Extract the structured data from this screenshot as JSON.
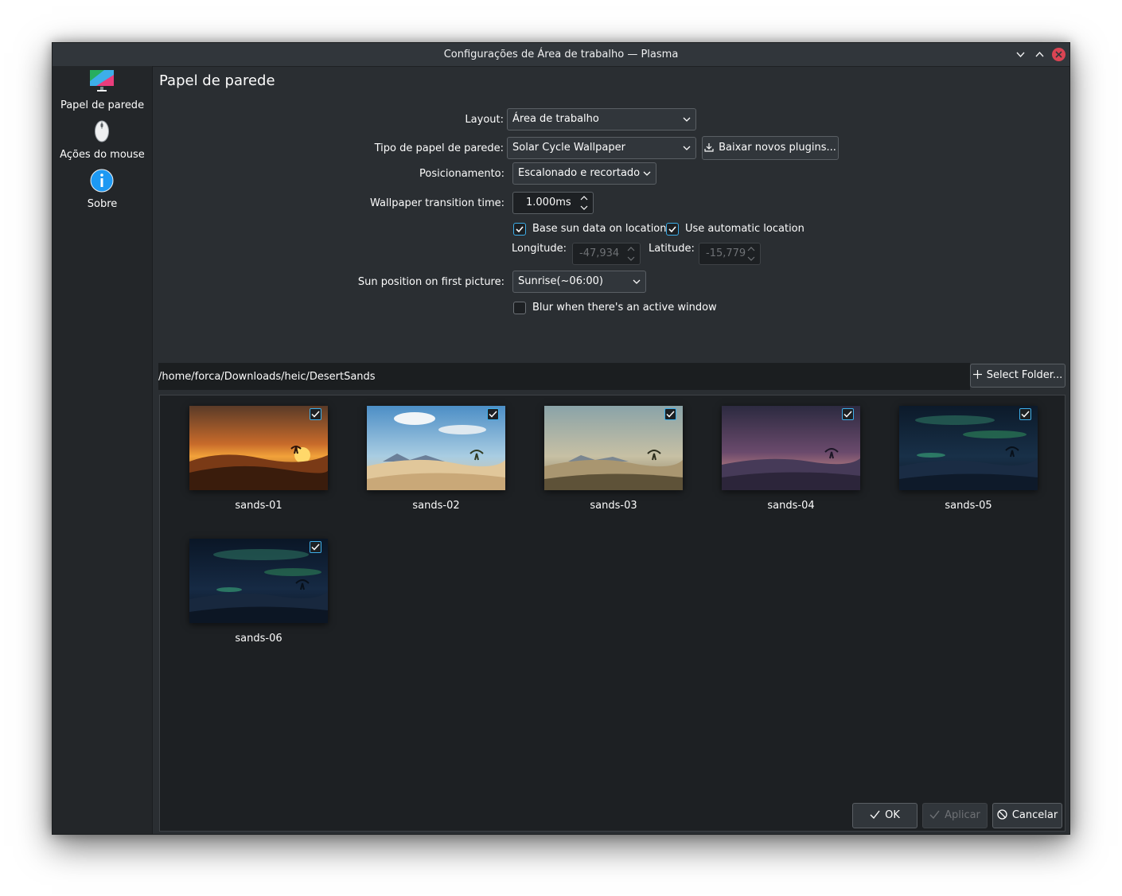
{
  "window": {
    "title": "Configurações de Área de trabalho — Plasma"
  },
  "sidebar": {
    "items": [
      {
        "label": "Papel de parede",
        "icon": "monitor-wallpaper-icon"
      },
      {
        "label": "Ações do mouse",
        "icon": "mouse-icon"
      },
      {
        "label": "Sobre",
        "icon": "info-icon"
      }
    ]
  },
  "page": {
    "title": "Papel de parede"
  },
  "form": {
    "layout_label": "Layout:",
    "layout_value": "Área de trabalho",
    "type_label": "Tipo de papel de parede:",
    "type_value": "Solar Cycle Wallpaper",
    "get_plugins": "Baixar novos plugins...",
    "position_label": "Posicionamento:",
    "position_value": "Escalonado e recortado",
    "transition_label": "Wallpaper transition time:",
    "transition_value": "1.000ms",
    "base_sun_label": "Base sun data on location",
    "base_sun_checked": true,
    "auto_location_label": "Use automatic location",
    "auto_location_checked": true,
    "longitude_label": "Longitude:",
    "longitude_value": "-47,934",
    "latitude_label": "Latitude:",
    "latitude_value": "-15,779",
    "sun_position_label": "Sun position on first picture:",
    "sun_position_value": "Sunrise(~06:00)",
    "blur_label": "Blur when there's an active window",
    "blur_checked": false
  },
  "folder": {
    "path": "/home/forca/Downloads/heic/DesertSands",
    "select_label": "Select Folder..."
  },
  "images": [
    {
      "name": "sands-01",
      "checked": true
    },
    {
      "name": "sands-02",
      "checked": true
    },
    {
      "name": "sands-03",
      "checked": true
    },
    {
      "name": "sands-04",
      "checked": true
    },
    {
      "name": "sands-05",
      "checked": true
    },
    {
      "name": "sands-06",
      "checked": true
    }
  ],
  "footer": {
    "ok": "OK",
    "apply": "Aplicar",
    "cancel": "Cancelar"
  },
  "colors": {
    "accent": "#3daee9",
    "window_bg": "#2a2e32",
    "sidebar_bg": "#232629",
    "close": "#da4453"
  }
}
